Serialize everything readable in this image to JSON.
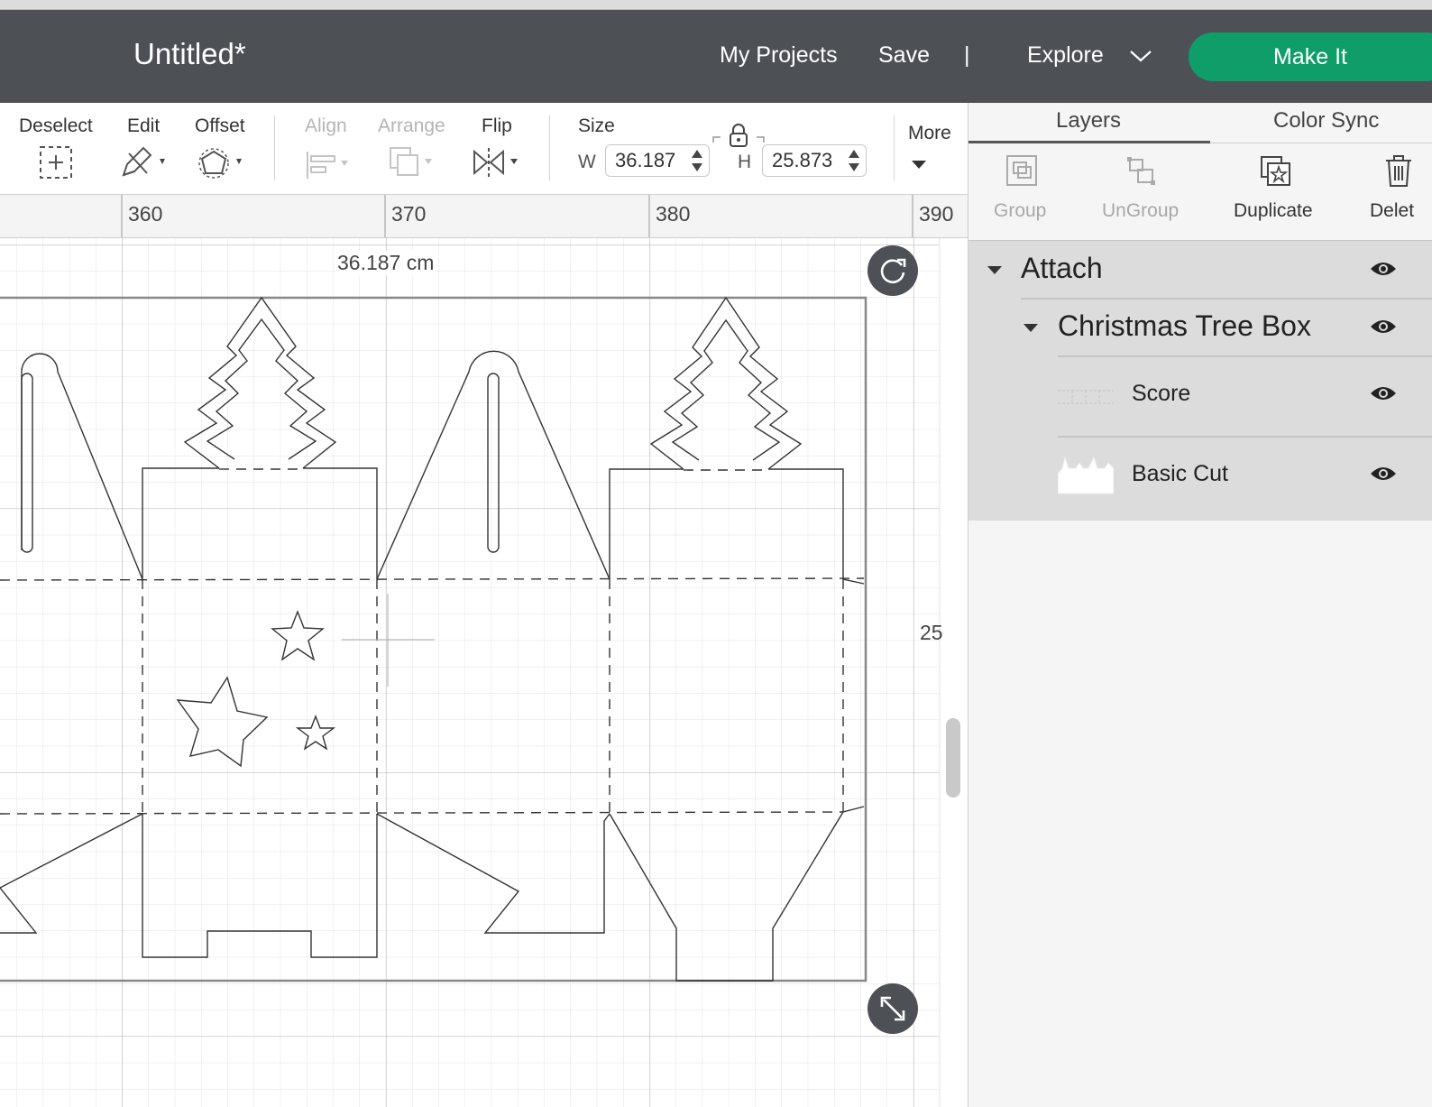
{
  "header": {
    "title": "Untitled*",
    "my_projects": "My Projects",
    "save": "Save",
    "separator": "|",
    "explore": "Explore",
    "make_it": "Make It",
    "make_it_color": "#0f9e6a"
  },
  "toolbar": {
    "deselect": "Deselect",
    "edit": "Edit",
    "offset": "Offset",
    "align": "Align",
    "arrange": "Arrange",
    "flip": "Flip",
    "size": "Size",
    "w_label": "W",
    "w_value": "36.187",
    "h_label": "H",
    "h_value": "25.873",
    "more": "More"
  },
  "ruler": {
    "ticks": [
      "360",
      "370",
      "380",
      "390"
    ]
  },
  "canvas": {
    "width_readout": "36.187 cm",
    "height_readout": "25"
  },
  "panel": {
    "tabs": [
      "Layers",
      "Color Sync"
    ],
    "tools": {
      "group": "Group",
      "ungroup": "UnGroup",
      "duplicate": "Duplicate",
      "delete": "Delet"
    },
    "layers": {
      "attach": "Attach",
      "group_name": "Christmas Tree Box",
      "score": "Score",
      "basic_cut": "Basic Cut"
    }
  },
  "icons": [
    "chevron-down-icon",
    "deselect-icon",
    "edit-icon",
    "offset-icon",
    "align-icon",
    "arrange-icon",
    "flip-icon",
    "lock-icon",
    "rotate-icon",
    "resize-icon",
    "eye-icon",
    "group-icon",
    "ungroup-icon",
    "duplicate-icon",
    "trash-icon"
  ]
}
